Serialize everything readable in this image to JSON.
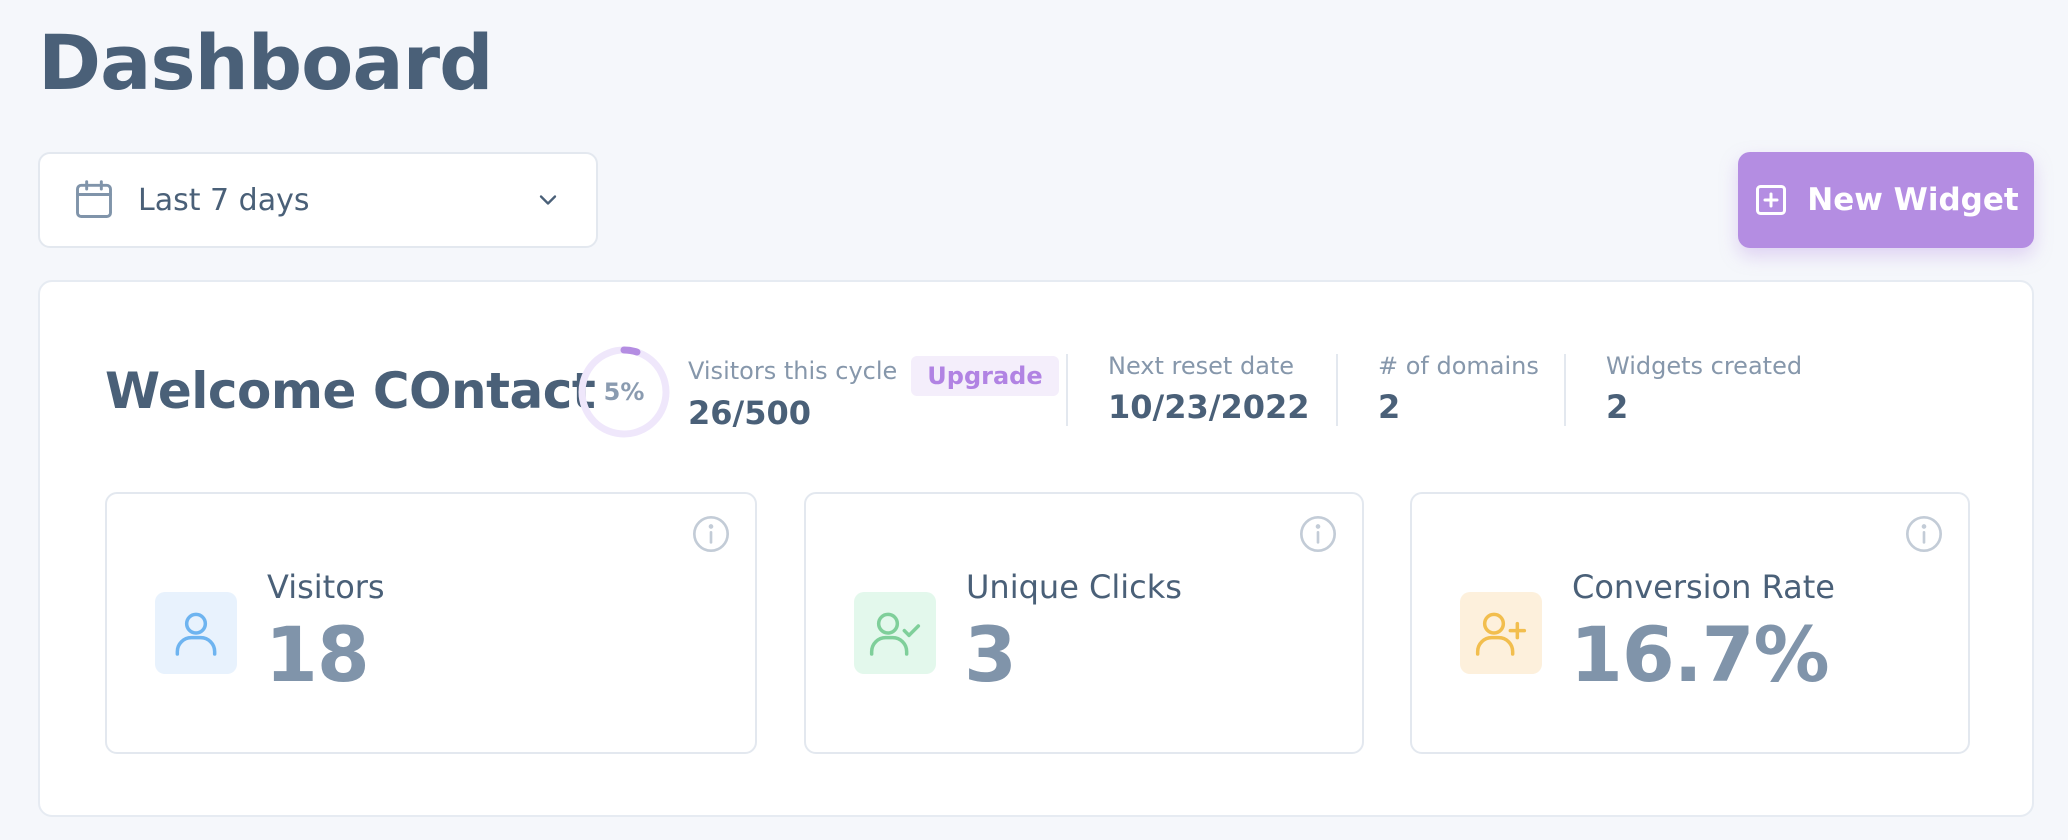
{
  "page_title": "Dashboard",
  "date_range": {
    "selected": "Last 7 days"
  },
  "new_widget_button": {
    "label": "New Widget"
  },
  "welcome": {
    "greeting": "Welcome COntact",
    "progress": {
      "label": "5%",
      "percent": 5
    },
    "visitors_cycle": {
      "label": "Visitors this cycle",
      "value": "26/500",
      "upgrade_label": "Upgrade"
    },
    "next_reset": {
      "label": "Next reset date",
      "value": "10/23/2022"
    },
    "domains": {
      "label": "# of domains",
      "value": "2"
    },
    "widgets_created": {
      "label": "Widgets created",
      "value": "2"
    }
  },
  "metrics": [
    {
      "label": "Visitors",
      "value": "18",
      "icon": "user-icon",
      "accent": "#6eb4f0",
      "bg": "#e8f2fd"
    },
    {
      "label": "Unique Clicks",
      "value": "3",
      "icon": "user-check-icon",
      "accent": "#7fcf9a",
      "bg": "#e3f8ec"
    },
    {
      "label": "Conversion Rate",
      "value": "16.7%",
      "icon": "user-plus-icon",
      "accent": "#f2be4e",
      "bg": "#fdf0dc"
    }
  ],
  "colors": {
    "accent_purple": "#b48de2",
    "text_primary": "#4a6078",
    "text_muted": "#8697ab"
  }
}
